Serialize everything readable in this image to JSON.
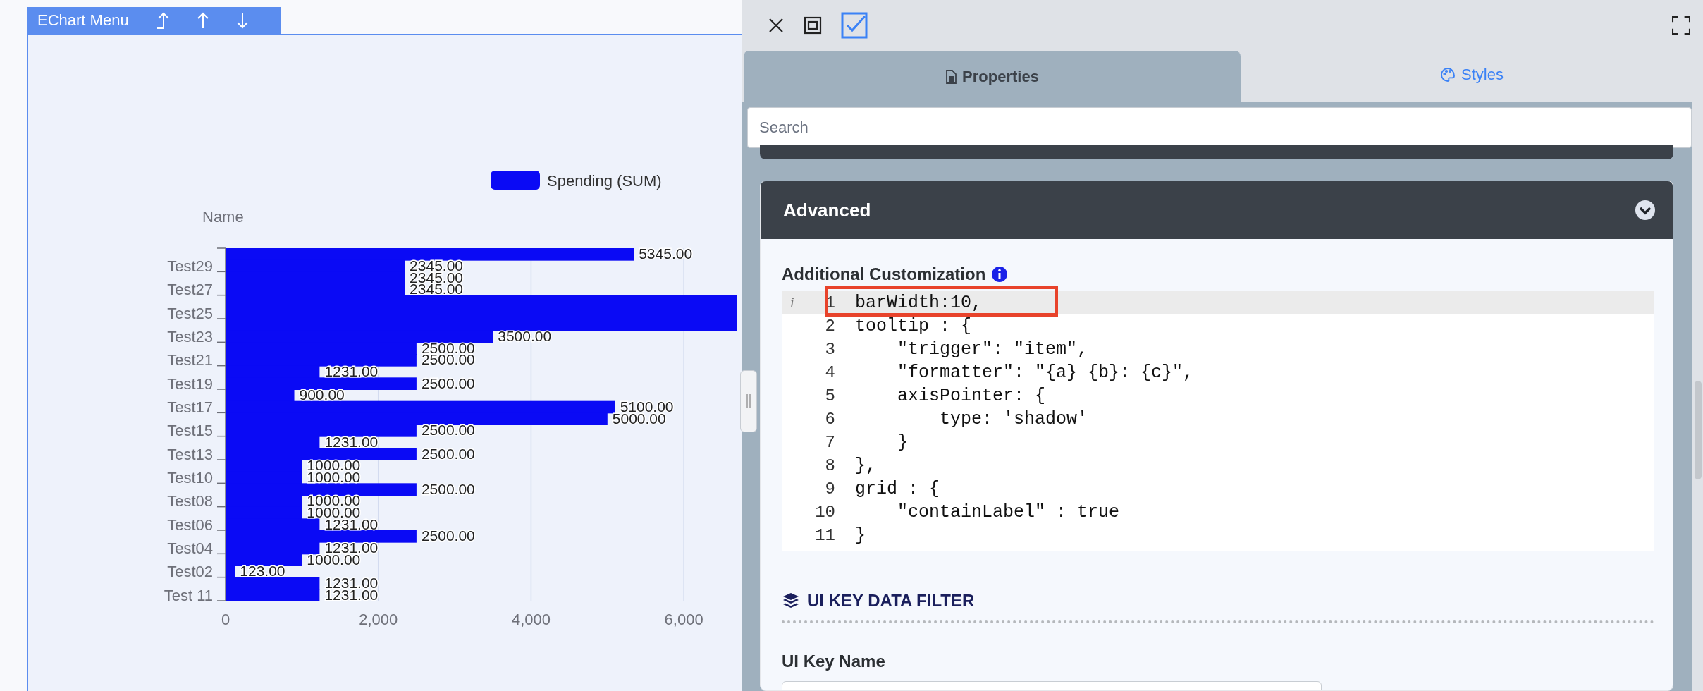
{
  "chart_panel": {
    "menu": {
      "title": "EChart Menu"
    },
    "chart_data": {
      "type": "bar",
      "orientation": "horizontal",
      "ylabel": "Name",
      "grid": true,
      "xlim": [
        0,
        6700
      ],
      "xticks": [
        0,
        {
          "value": 2000,
          "label": "2,000"
        },
        {
          "value": 4000,
          "label": "4,000"
        },
        {
          "value": 6000,
          "label": "6,000"
        }
      ],
      "categories": [
        null,
        "Test29",
        null,
        "Test27",
        null,
        "Test25",
        null,
        "Test23",
        null,
        "Test21",
        null,
        "Test19",
        null,
        "Test17",
        null,
        "Test15",
        null,
        "Test13",
        null,
        "Test10",
        null,
        "Test08",
        null,
        "Test06",
        null,
        "Test04",
        null,
        "Test02",
        null,
        "Test 11"
      ],
      "series": [
        {
          "name": "Spending (SUM)",
          "color": "#0a0af5",
          "values": [
            5345,
            2345,
            2345,
            2345,
            6700,
            6700,
            6700,
            3500,
            2500,
            2500,
            1231,
            2500,
            900,
            5100,
            5000,
            2500,
            1231,
            2500,
            1000,
            1000,
            2500,
            1000,
            1000,
            1231,
            2500,
            1231,
            1000,
            123,
            1231,
            1231
          ]
        }
      ],
      "value_labels": [
        "5345.00",
        "2345.00",
        "2345.00",
        "2345.00",
        null,
        null,
        null,
        "3500.00",
        "2500.00",
        "2500.00",
        "1231.00",
        "2500.00",
        "900.00",
        "5100.00",
        "5000.00",
        "2500.00",
        "1231.00",
        "2500.00",
        "1000.00",
        "1000.00",
        "2500.00",
        "1000.00",
        "1000.00",
        "1231.00",
        "2500.00",
        "1231.00",
        "1000.00",
        "123.00",
        "1231.00",
        "1231.00"
      ]
    }
  },
  "properties_panel": {
    "tabs": [
      {
        "label": "Properties",
        "selected": true
      },
      {
        "label": "Styles",
        "selected": false
      }
    ],
    "search": {
      "placeholder": "Search"
    },
    "section": {
      "title": "Advanced",
      "expanded": true,
      "field_label": "Additional Customization",
      "code_lines": [
        {
          "number": "1",
          "text": "barWidth:10,",
          "active": true,
          "marker": "i",
          "annotated": true
        },
        {
          "number": "2",
          "text": "tooltip : {",
          "active": false,
          "annotated": false
        },
        {
          "number": "3",
          "text": "    \"trigger\": \"item\",",
          "active": false,
          "annotated": false
        },
        {
          "number": "4",
          "text": "    \"formatter\": \"{a} {b}: {c}\",",
          "active": false,
          "annotated": false
        },
        {
          "number": "5",
          "text": "    axisPointer: {",
          "active": false,
          "annotated": false
        },
        {
          "number": "6",
          "text": "        type: 'shadow'",
          "active": false,
          "annotated": false
        },
        {
          "number": "7",
          "text": "    }",
          "active": false,
          "annotated": false
        },
        {
          "number": "8",
          "text": "},",
          "active": false,
          "annotated": false
        },
        {
          "number": "9",
          "text": "grid : {",
          "active": false,
          "annotated": false
        },
        {
          "number": "10",
          "text": "    \"containLabel\" : true",
          "active": false,
          "annotated": false
        },
        {
          "number": "11",
          "text": "}",
          "active": false,
          "annotated": false
        }
      ],
      "filter_title": "UI KEY DATA FILTER",
      "filter_field_label": "UI Key Name"
    }
  }
}
